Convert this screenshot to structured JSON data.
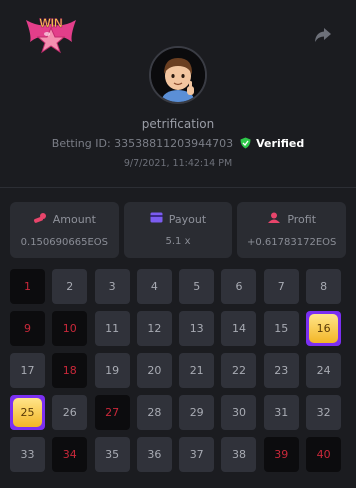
{
  "header": {
    "logo_text": "WIN",
    "logo_icon": "win-star-logo",
    "share_icon": "share-icon"
  },
  "profile": {
    "username": "petrification",
    "betting_id_label": "Betting ID:",
    "betting_id": "33538811203944703",
    "verified_label": "Verified",
    "timestamp": "9/7/2021, 11:42:14 PM"
  },
  "stats": {
    "amount": {
      "label": "Amount",
      "value": "0.150690665EOS",
      "icon": "coins-icon"
    },
    "payout": {
      "label": "Payout",
      "value": "5.1 x",
      "icon": "card-icon"
    },
    "profit": {
      "label": "Profit",
      "value": "+0.61783172EOS",
      "icon": "profit-icon"
    }
  },
  "colors": {
    "background": "#1b1c20",
    "cell": "#30323a",
    "red_text": "#c9283a",
    "highlight": "#7b2ff2",
    "accent_pink": "#e8456b",
    "verified_green": "#2ec84a"
  },
  "grid": [
    {
      "n": "1",
      "t": "red"
    },
    {
      "n": "2",
      "t": "normal"
    },
    {
      "n": "3",
      "t": "normal"
    },
    {
      "n": "4",
      "t": "normal"
    },
    {
      "n": "5",
      "t": "normal"
    },
    {
      "n": "6",
      "t": "normal"
    },
    {
      "n": "7",
      "t": "normal"
    },
    {
      "n": "8",
      "t": "normal"
    },
    {
      "n": "9",
      "t": "red"
    },
    {
      "n": "10",
      "t": "red"
    },
    {
      "n": "11",
      "t": "normal"
    },
    {
      "n": "12",
      "t": "normal"
    },
    {
      "n": "13",
      "t": "normal"
    },
    {
      "n": "14",
      "t": "normal"
    },
    {
      "n": "15",
      "t": "normal"
    },
    {
      "n": "16",
      "t": "hit"
    },
    {
      "n": "17",
      "t": "normal"
    },
    {
      "n": "18",
      "t": "red"
    },
    {
      "n": "19",
      "t": "normal"
    },
    {
      "n": "20",
      "t": "normal"
    },
    {
      "n": "21",
      "t": "normal"
    },
    {
      "n": "22",
      "t": "normal"
    },
    {
      "n": "23",
      "t": "normal"
    },
    {
      "n": "24",
      "t": "normal"
    },
    {
      "n": "25",
      "t": "hit"
    },
    {
      "n": "26",
      "t": "normal"
    },
    {
      "n": "27",
      "t": "red"
    },
    {
      "n": "28",
      "t": "normal"
    },
    {
      "n": "29",
      "t": "normal"
    },
    {
      "n": "30",
      "t": "normal"
    },
    {
      "n": "31",
      "t": "normal"
    },
    {
      "n": "32",
      "t": "normal"
    },
    {
      "n": "33",
      "t": "normal"
    },
    {
      "n": "34",
      "t": "red"
    },
    {
      "n": "35",
      "t": "normal"
    },
    {
      "n": "36",
      "t": "normal"
    },
    {
      "n": "37",
      "t": "normal"
    },
    {
      "n": "38",
      "t": "normal"
    },
    {
      "n": "39",
      "t": "red"
    },
    {
      "n": "40",
      "t": "red"
    }
  ]
}
